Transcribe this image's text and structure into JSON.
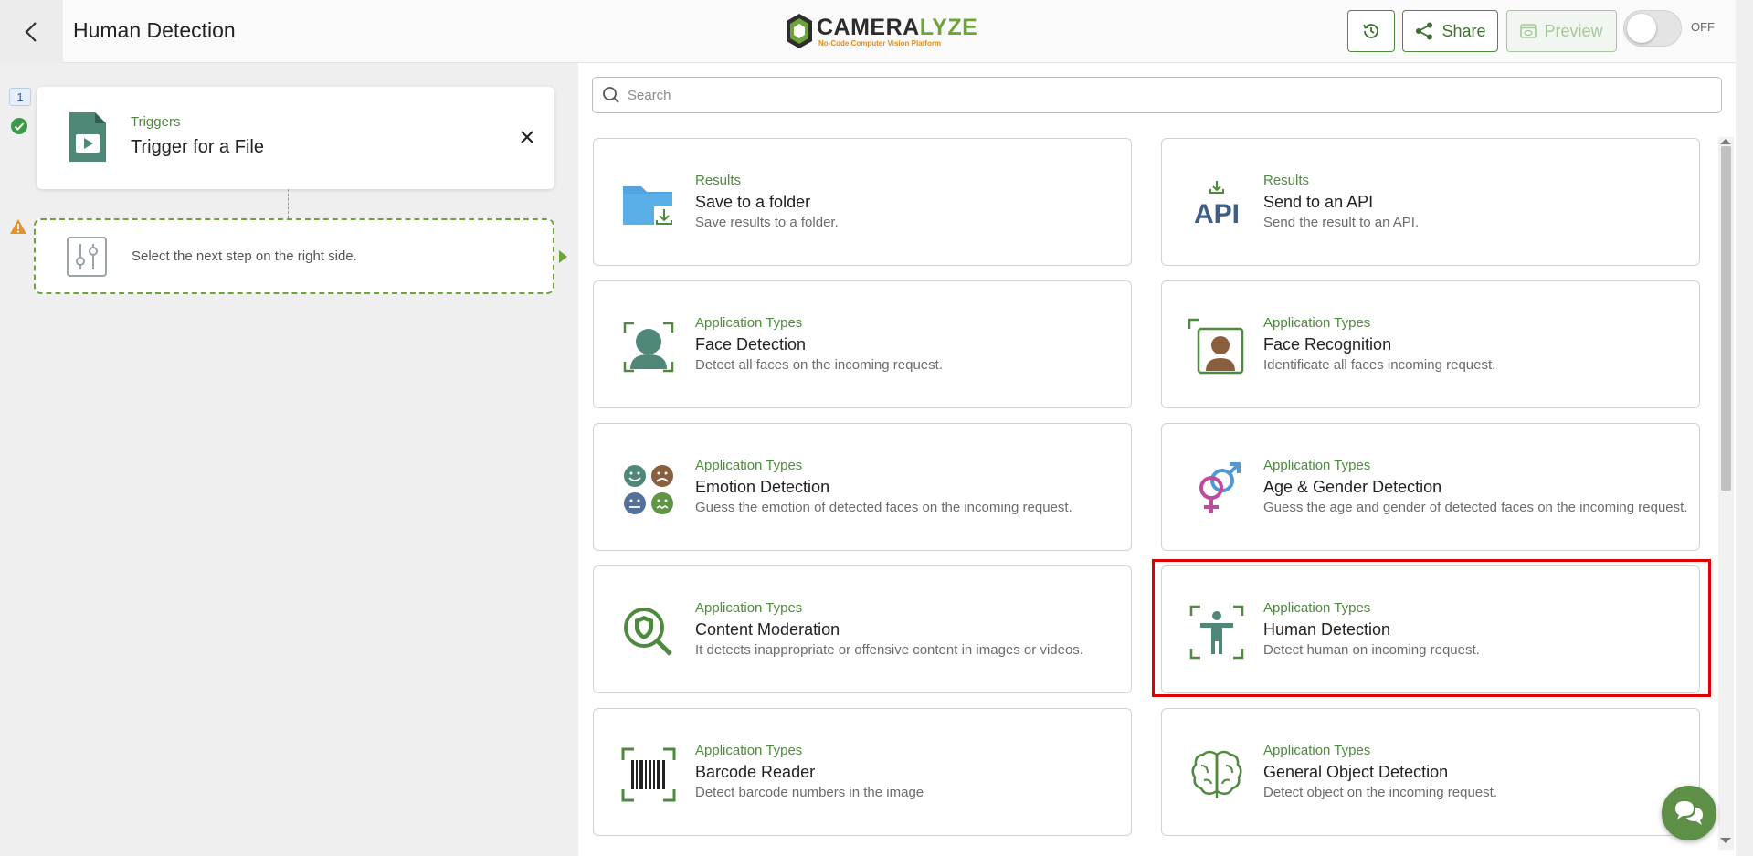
{
  "header": {
    "page_title": "Human Detection",
    "logo_name_pre": "CAMERA",
    "logo_name_post": "LYZE",
    "logo_tagline": "No-Code Computer Vision Platform",
    "share_label": "Share",
    "preview_label": "Preview",
    "toggle_label": "OFF"
  },
  "flow": {
    "step_number": "1",
    "trigger": {
      "category": "Triggers",
      "title": "Trigger for a File"
    },
    "next_step_text": "Select the next step on the right side."
  },
  "search": {
    "placeholder": "Search",
    "value": ""
  },
  "cards": [
    {
      "icon": "folder-download-icon",
      "category": "Results",
      "title": "Save to a folder",
      "description": "Save results to a folder."
    },
    {
      "icon": "api-icon",
      "category": "Results",
      "title": "Send to an API",
      "description": "Send the result to an API.",
      "icon_text": "API"
    },
    {
      "icon": "face-detection-icon",
      "category": "Application Types",
      "title": "Face Detection",
      "description": "Detect all faces on the incoming request."
    },
    {
      "icon": "face-recognition-icon",
      "category": "Application Types",
      "title": "Face Recognition",
      "description": "Identificate all faces incoming request."
    },
    {
      "icon": "emotion-icon",
      "category": "Application Types",
      "title": "Emotion Detection",
      "description": "Guess the emotion of detected faces on the incoming request."
    },
    {
      "icon": "gender-icon",
      "category": "Application Types",
      "title": "Age & Gender Detection",
      "description": "Guess the age and gender of detected faces on the incoming request."
    },
    {
      "icon": "moderation-icon",
      "category": "Application Types",
      "title": "Content Moderation",
      "description": "It detects inappropriate or offensive content in images or videos."
    },
    {
      "icon": "human-detection-icon",
      "category": "Application Types",
      "title": "Human Detection",
      "description": "Detect human on incoming request."
    },
    {
      "icon": "barcode-icon",
      "category": "Application Types",
      "title": "Barcode Reader",
      "description": "Detect barcode numbers in the image"
    },
    {
      "icon": "brain-icon",
      "category": "Application Types",
      "title": "General Object Detection",
      "description": "Detect object on the incoming request."
    }
  ],
  "colors": {
    "accent": "#4e8a3e",
    "highlight": "#e00000",
    "chat": "#5d8f46"
  }
}
